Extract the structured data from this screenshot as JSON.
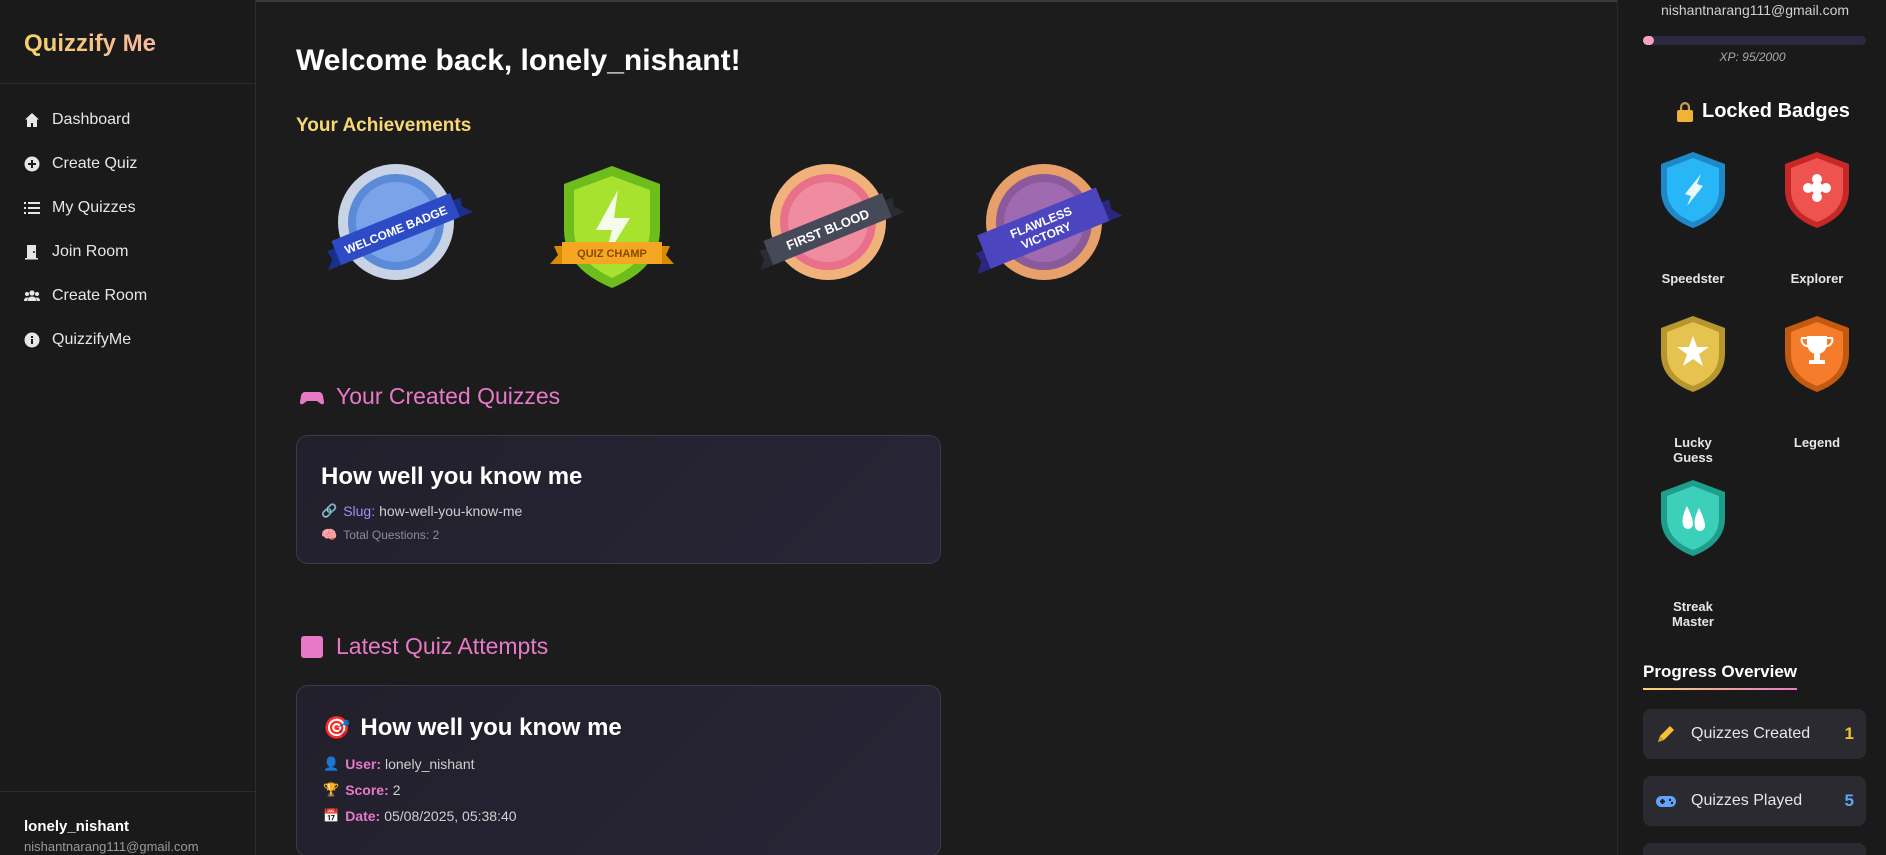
{
  "app": {
    "brand": "Quizzify Me"
  },
  "sidebar": {
    "items": [
      {
        "label": "Dashboard",
        "icon": "home-icon"
      },
      {
        "label": "Create Quiz",
        "icon": "plus-circle-icon"
      },
      {
        "label": "My Quizzes",
        "icon": "list-icon"
      },
      {
        "label": "Join Room",
        "icon": "door-icon"
      },
      {
        "label": "Create Room",
        "icon": "users-icon"
      },
      {
        "label": "QuizzifyMe",
        "icon": "info-icon"
      }
    ],
    "user": {
      "name": "lonely_nishant",
      "email": "nishantnarang111@gmail.com"
    }
  },
  "main": {
    "welcome": "Welcome back, lonely_nishant!",
    "achievements_title": "Your Achievements",
    "badges": [
      {
        "label": "WELCOME BADGE"
      },
      {
        "label": "QUIZ CHAMP"
      },
      {
        "label": "FIRST BLOOD"
      },
      {
        "label": "FLAWLESS",
        "label2": "VICTORY"
      }
    ],
    "created": {
      "title": "Your Created Quizzes",
      "quiz": {
        "title": "How well you know me",
        "slug_label": "Slug:",
        "slug": "how-well-you-know-me",
        "total_questions": "Total Questions: 2"
      }
    },
    "attempts": {
      "title": "Latest Quiz Attempts",
      "attempt": {
        "title": "How well you know me",
        "user_label": "User:",
        "user": "lonely_nishant",
        "score_label": "Score:",
        "score": "2",
        "date_label": "Date:",
        "date": "05/08/2025, 05:38:40"
      }
    }
  },
  "right": {
    "email": "nishantnarang111@gmail.com",
    "xp_text": "XP: 95/2000",
    "xp_progress": 0.0475,
    "locked_title": "Locked Badges",
    "locked_badges": [
      {
        "label": "Speedster",
        "color": "#29b6f6"
      },
      {
        "label": "Explorer",
        "color": "#ef5350"
      },
      {
        "label": "Lucky Guess",
        "color": "#e6c34f"
      },
      {
        "label": "Legend",
        "color": "#f57c2a"
      },
      {
        "label": "Streak Master",
        "color": "#3ccfb9"
      }
    ],
    "progress_title": "Progress Overview",
    "stats": [
      {
        "label": "Quizzes Created",
        "value": "1",
        "color": "#f2c230"
      },
      {
        "label": "Quizzes Played",
        "value": "5",
        "color": "#60a5fa"
      }
    ]
  }
}
